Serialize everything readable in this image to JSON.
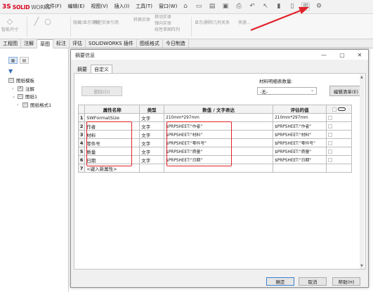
{
  "app": {
    "logo_ds": "3S",
    "logo_solid": "SOLID",
    "logo_works": "WORKS"
  },
  "menu": [
    {
      "label": "文件(F)"
    },
    {
      "label": "编辑(E)"
    },
    {
      "label": "视图(V)"
    },
    {
      "label": "插入(I)"
    },
    {
      "label": "工具(T)"
    },
    {
      "label": "窗口(W)"
    }
  ],
  "commands": {
    "smart_dim": "智能尺寸",
    "hide_show": "隐藏/显示实体",
    "model_ref": "模型实体引用",
    "tx_entity": "转换实体",
    "move_entity": "移动实体",
    "mirror_entity": "镜向实体",
    "linear_array": "线性草图阵列",
    "show_rel": "显示/删除几何关系",
    "quick": "快速..."
  },
  "tabs": [
    {
      "label": "工程图"
    },
    {
      "label": "注解"
    },
    {
      "label": "草图"
    },
    {
      "label": "标注"
    },
    {
      "label": "评估"
    },
    {
      "label": "SOLIDWORKS 插件"
    },
    {
      "label": "图纸格式"
    },
    {
      "label": "今日制造"
    }
  ],
  "tree": {
    "root": "图纸模板",
    "annotation": "注解",
    "sheet1": "图纸1",
    "format1": "图纸格式1"
  },
  "dialog": {
    "title": "摘要信息",
    "tab_summary": "摘要",
    "tab_custom": "自定义",
    "delete_label": "删除(D)",
    "bom_label": "材料明细表数量:",
    "bom_value": "-无-",
    "edit_list_label": "编辑清单(E)",
    "ok_label": "确定",
    "cancel_label": "取消",
    "help_label": "帮助(H)"
  },
  "grid": {
    "headers": [
      "",
      "属性名称",
      "类型",
      "数值 / 文字表达",
      "评估的值",
      ""
    ],
    "rows": [
      {
        "n": "1",
        "name": "SWFormatSize",
        "type": "文字",
        "value": "210mm*297mm",
        "eval": "210mm*297mm"
      },
      {
        "n": "2",
        "name": "作者",
        "type": "文字",
        "value": "$PRPSHEET:\"作者\"",
        "eval": "$PRPSHEET:\"作者\""
      },
      {
        "n": "3",
        "name": "材料",
        "type": "文字",
        "value": "$PRPSHEET:\"材料\"",
        "eval": "$PRPSHEET:\"材料\""
      },
      {
        "n": "4",
        "name": "零件号",
        "type": "文字",
        "value": "$PRPSHEET:\"零件号\"",
        "eval": "$PRPSHEET:\"零件号\""
      },
      {
        "n": "5",
        "name": "质量",
        "type": "文字",
        "value": "$PRPSHEET:\"质量\"",
        "eval": "$PRPSHEET:\"质量\""
      },
      {
        "n": "6",
        "name": "日期",
        "type": "文字",
        "value": "$PRPSHEET:\"日期\"",
        "eval": "$PRPSHEET:\"日期\""
      }
    ],
    "new_row_n": "7",
    "new_row_label": "<键入新属性>"
  },
  "colors": {
    "accent": "#d6001c",
    "annotation_red": "#e1232a",
    "default_button_border": "#3c7fd0"
  }
}
